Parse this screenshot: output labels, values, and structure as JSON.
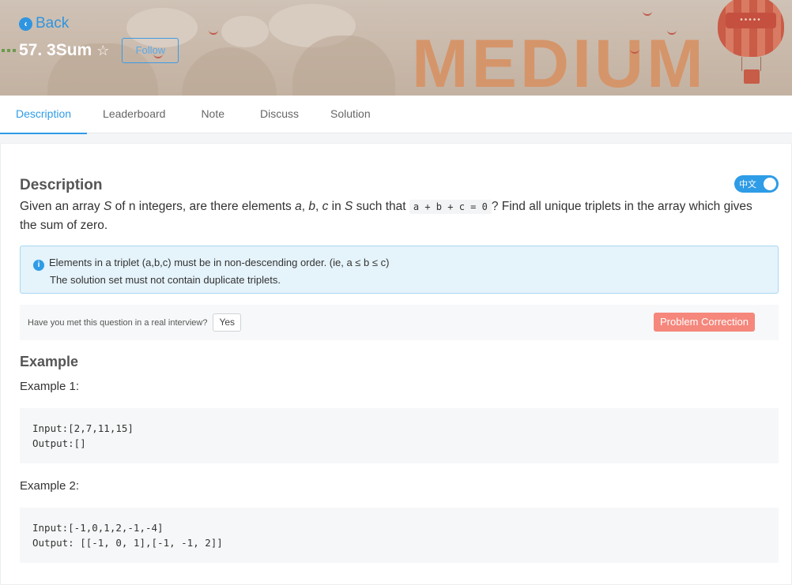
{
  "header": {
    "back_label": "Back",
    "problem_title": "57. 3Sum",
    "follow_label": "Follow",
    "difficulty_word": "MEDIUM",
    "balloon_text": "•••••"
  },
  "tabs": [
    {
      "label": "Description",
      "active": true
    },
    {
      "label": "Leaderboard",
      "active": false
    },
    {
      "label": "Note",
      "active": false
    },
    {
      "label": "Discuss",
      "active": false
    },
    {
      "label": "Solution",
      "active": false
    }
  ],
  "description": {
    "heading": "Description",
    "lang_toggle_label": "中文",
    "text_parts": {
      "p1": "Given an array ",
      "S1": "S",
      "p2": " of n integers, are there elements ",
      "a": "a",
      "c1": ", ",
      "b": "b",
      "c2": ", ",
      "c": "c",
      "p3": " in ",
      "S2": "S",
      "p4": " such that ",
      "code": "a + b + c = 0",
      "p5": "? Find all unique triplets in the array which gives the sum of zero."
    },
    "notice_line1": "Elements in a triplet (a,b,c) must be in non-descending order. (ie, a ≤ b ≤ c)",
    "notice_line2": "The solution set must not contain duplicate triplets."
  },
  "interview": {
    "question": "Have you met this question in a real interview?",
    "yes_label": "Yes",
    "correction_label": "Problem Correction"
  },
  "examples": {
    "heading": "Example",
    "ex1_title": "Example 1:",
    "ex1_code": "Input:[2,7,11,15]\nOutput:[]",
    "ex2_title": "Example 2:",
    "ex2_code": "Input:[-1,0,1,2,-1,-4]\nOutput: [[-1, 0, 1],[-1, -1, 2]]"
  },
  "colors": {
    "accent": "#2e9ce6",
    "correction": "#f5877c",
    "difficulty": "#d5956a"
  }
}
